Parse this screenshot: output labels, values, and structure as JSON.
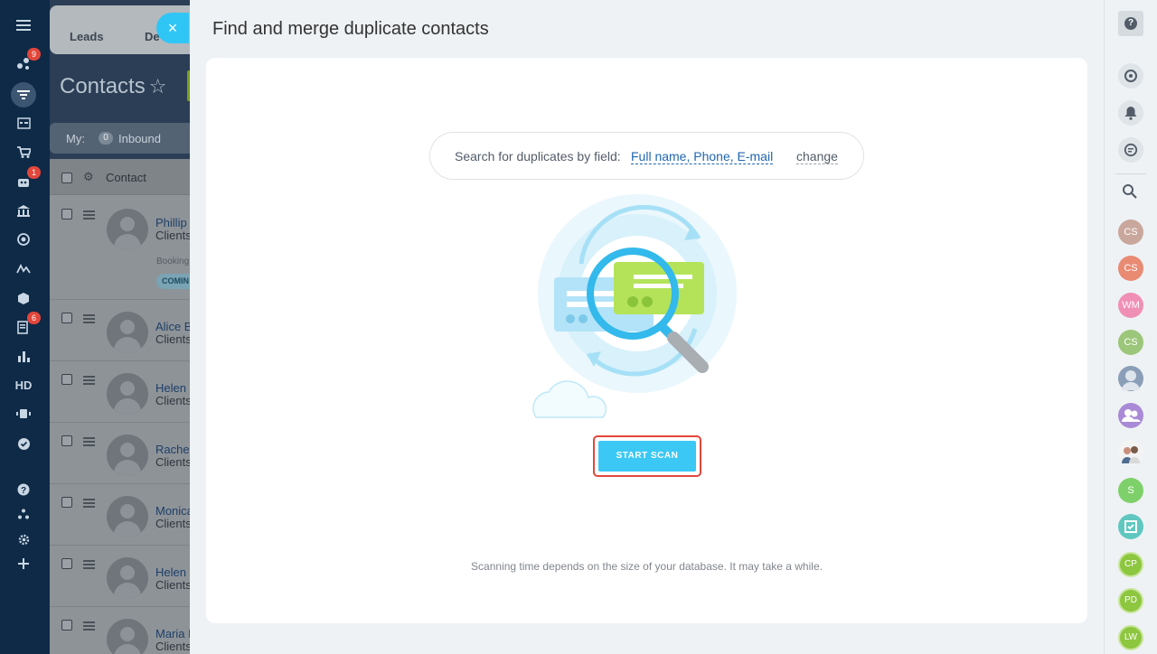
{
  "nav": {
    "items": [
      {
        "icon": "menu-icon"
      },
      {
        "icon": "activity-stream-icon",
        "badge": "9"
      },
      {
        "icon": "crm-funnel-icon"
      },
      {
        "icon": "tasks-icon"
      },
      {
        "icon": "cart-icon"
      },
      {
        "icon": "robot-icon",
        "badge": "1"
      },
      {
        "icon": "bank-icon"
      },
      {
        "icon": "target-icon"
      },
      {
        "icon": "sign-icon"
      },
      {
        "icon": "box-icon"
      },
      {
        "icon": "document-edit-icon",
        "badge": "6"
      },
      {
        "icon": "bar-chart-icon"
      },
      {
        "icon": "hd-icon",
        "label": "HD"
      },
      {
        "icon": "network-icon"
      },
      {
        "icon": "check-circle-icon"
      },
      {
        "icon": "help-icon"
      },
      {
        "icon": "sitemap-icon"
      },
      {
        "icon": "settings-icon"
      },
      {
        "icon": "add-icon"
      }
    ]
  },
  "crm": {
    "tabs": [
      "Leads",
      "De"
    ],
    "title": "Contacts",
    "filter": {
      "my": "My:",
      "count": "0",
      "label": "Inbound"
    },
    "column_header": "Contact",
    "rows": [
      {
        "name": "Phillip",
        "sub": "Clients",
        "booking": "Booking",
        "pill": "COMIN"
      },
      {
        "name": "Alice B",
        "sub": "Clients"
      },
      {
        "name": "Helen",
        "sub": "Clients"
      },
      {
        "name": "Rachel",
        "sub": "Clients"
      },
      {
        "name": "Monica",
        "sub": "Clients"
      },
      {
        "name": "Helen S",
        "sub": "Clients"
      },
      {
        "name": "Maria D",
        "sub": "Clients"
      }
    ]
  },
  "close_label": "×",
  "panel": {
    "title": "Find and merge duplicate contacts",
    "search_label": "Search for duplicates by field:",
    "search_fields": "Full name, Phone, E-mail",
    "change_label": "change",
    "scan_button": "START SCAN",
    "note": "Scanning time depends on the size of your database. It may take a while."
  },
  "rightrail": {
    "help": "?",
    "icons": [
      "sync-icon",
      "bell-icon",
      "chat-icon"
    ],
    "search_icon": "search-icon",
    "users": [
      {
        "initials": "CS",
        "color": "#c9a79c"
      },
      {
        "initials": "CS",
        "color": "#e98a73"
      },
      {
        "initials": "WM",
        "color": "#f08fb5"
      },
      {
        "initials": "CS",
        "color": "#9cc67a"
      },
      {
        "initials": "",
        "color": "#8b9eb8",
        "photo": true
      },
      {
        "initials": "",
        "color": "#a98ad6",
        "group": true
      },
      {
        "initials": "",
        "color": "#f3f3f3",
        "photo2": true
      },
      {
        "initials": "S",
        "color": "#7ed16a"
      },
      {
        "initials": "",
        "color": "#5fc7c0",
        "task": true
      }
    ],
    "hex_users": [
      "CP",
      "PD",
      "LW"
    ]
  }
}
